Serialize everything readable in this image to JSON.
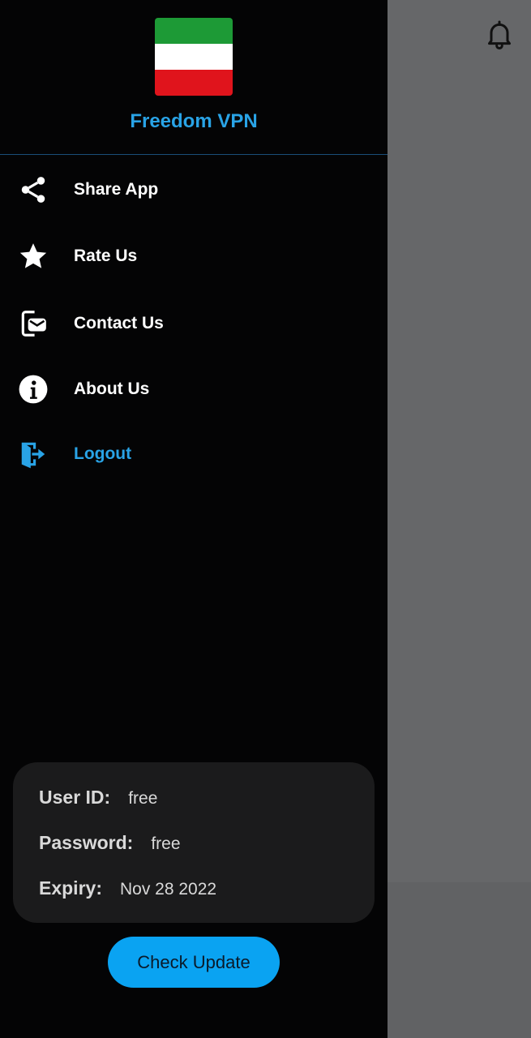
{
  "drawer": {
    "app_name": "Freedom VPN",
    "flag_colors": [
      "#1d9a36",
      "#ffffff",
      "#e0141c"
    ],
    "menu": [
      {
        "id": "share",
        "label": "Share App",
        "icon": "share-icon"
      },
      {
        "id": "rate",
        "label": "Rate Us",
        "icon": "star-icon"
      },
      {
        "id": "contact",
        "label": "Contact Us",
        "icon": "contact-mail-icon"
      },
      {
        "id": "about",
        "label": "About Us",
        "icon": "info-icon"
      },
      {
        "id": "logout",
        "label": "Logout",
        "icon": "logout-icon"
      }
    ]
  },
  "account": {
    "user_id_label": "User ID:",
    "user_id_value": "free",
    "password_label": "Password:",
    "password_value": "free",
    "expiry_label": "Expiry:",
    "expiry_value": "Nov 28 2022"
  },
  "check_update_label": "Check Update",
  "colors": {
    "accent": "#29a3e6",
    "button": "#0aa3f2",
    "drawer_bg": "#040405",
    "card_bg": "#1b1b1c",
    "scrim": "#666769"
  },
  "scrim": {
    "icon": "bell-icon"
  }
}
